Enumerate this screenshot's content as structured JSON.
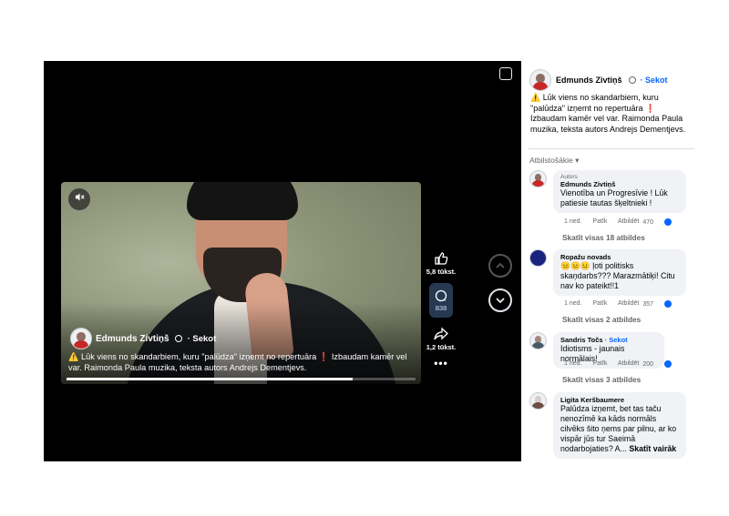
{
  "video": {
    "author": "Edmunds Zivtiņš",
    "follow": "· Sekot",
    "caption": "⚠️ Lūk viens no skandarbiem, kuru \"palūdza\" izņemt no repertuāra ❗ Izbaudam kamēr vel var. Raimonda Paula muzika, teksta autors Andrejs Dementjevs.",
    "progress": 0.82
  },
  "actions": {
    "likes": "5,8 tūkst.",
    "comments": "838",
    "shares": "1,2 tūkst."
  },
  "panel": {
    "author": "Edmunds Zivtiņš",
    "follow": "· Sekot",
    "caption": "⚠️ Lūk viens no skandarbiem, kuru \"palūdza\" izņemt no repertuāra ❗  Izbaudam kamēr vel var. Raimonda Paula muzika, teksta autors Andrejs Dementjevs.",
    "sort_label": "Atbilstošākie ▾"
  },
  "comments": [
    {
      "badge": "Autors",
      "name": "Edmunds Zivtiņš",
      "text": "Vienotība un Progresīvie ! Lūk patiesie tautas šķeltnieki !",
      "time": "1 ned.",
      "like": "Patīk",
      "reply": "Atbildēt",
      "likes": "470",
      "replies": "Skatīt visas 18 atbildes"
    },
    {
      "name": "Ropažu novads",
      "text": "😐😐😐 ļoti politisks skaņdarbs??? Marazmātiķi! Citu nav ko pateikt!!1",
      "time": "1 ned.",
      "like": "Patīk",
      "reply": "Atbildēt",
      "likes": "357",
      "replies": "Skatīt visas 2 atbildes"
    },
    {
      "name": "Sandris Točs",
      "follow": "· Sekot",
      "text": "Idiotisms - jaunais normālais!",
      "time": "1 ned.",
      "like": "Patīk",
      "reply": "Atbildēt",
      "likes": "200",
      "replies": "Skatīt visas 3 atbildes"
    },
    {
      "name": "Ligita Keršbaumere",
      "text": "Palūdza izņemt, bet tas taču nenozīmē ka kāds normāls cilvēks šito ņems par pilnu, ar ko vispār jūs tur Saeimā nodarbojaties? A...",
      "see_more": "Skatīt vairāk"
    }
  ],
  "colors": {
    "accent": "#0866ff",
    "bubble": "#f0f2f5",
    "player_bg": "#000000"
  },
  "icons": [
    "mute-icon",
    "like-icon",
    "comment-icon",
    "share-icon",
    "more-icon",
    "chevron-up-icon",
    "chevron-down-icon",
    "expand-icon",
    "verified-icon"
  ]
}
